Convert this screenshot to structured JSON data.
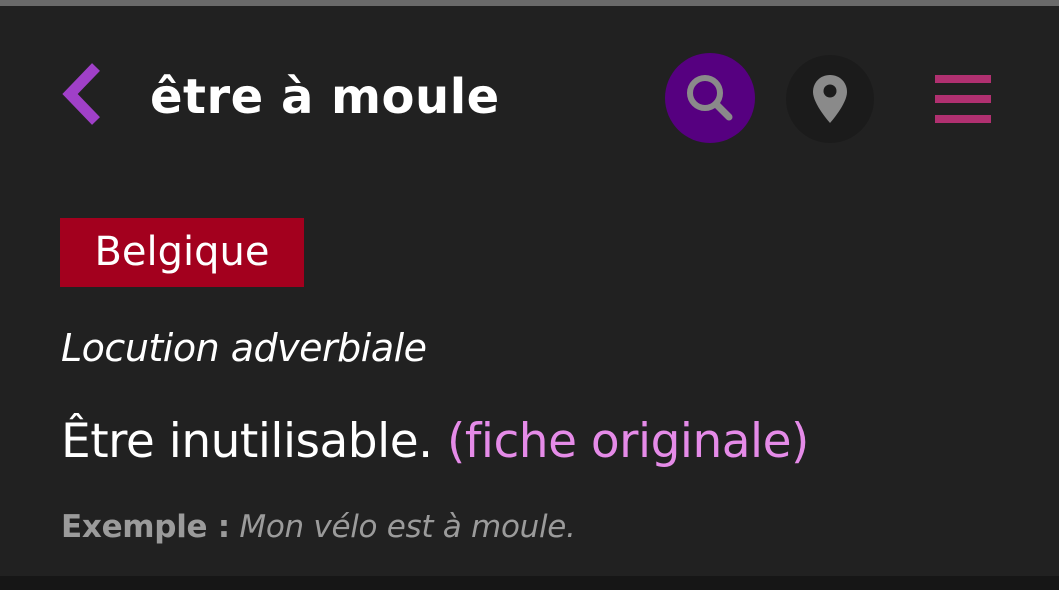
{
  "header": {
    "title": "être à moule",
    "back_icon": "chevron-left-icon",
    "search_icon": "search-icon",
    "location_icon": "map-pin-icon",
    "menu_icon": "hamburger-menu-icon"
  },
  "entry": {
    "region": "Belgique",
    "word_class": "Locution adverbiale",
    "definition": "Être inutilisable.",
    "source_link": "(fiche originale)",
    "example_label": "Exemple :",
    "example_text": "Mon vélo est à moule."
  },
  "colors": {
    "background": "#212121",
    "back_chevron": "#a040c8",
    "search_button_bg": "#560080",
    "search_icon": "#8a8a8a",
    "location_button_bg": "#1b1b1b",
    "location_icon": "#8a8a8a",
    "menu_icon": "#b03070",
    "region_badge_bg": "#a3001e",
    "link": "#e58be8",
    "example_text": "#9b9b9b"
  }
}
